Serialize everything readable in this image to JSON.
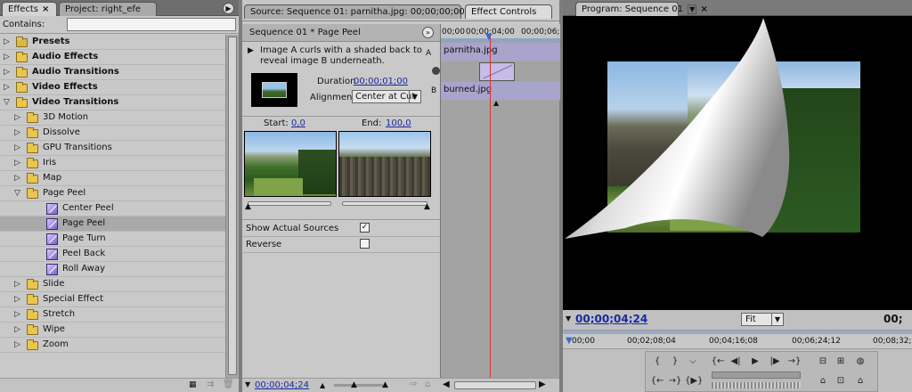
{
  "effects_panel": {
    "tabs": [
      {
        "label": "Effects",
        "close": "×"
      },
      {
        "label": "Project: right_efe"
      }
    ],
    "menu_glyph": "▶",
    "contains_label": "Contains:",
    "contains_value": "",
    "tree": [
      {
        "label": "Presets",
        "level": 0,
        "bold": true,
        "icon": "preset-folder-icon"
      },
      {
        "label": "Audio Effects",
        "level": 0,
        "bold": true,
        "icon": "folder-icon"
      },
      {
        "label": "Audio Transitions",
        "level": 0,
        "bold": true,
        "icon": "folder-icon"
      },
      {
        "label": "Video Effects",
        "level": 0,
        "bold": true,
        "icon": "folder-icon"
      },
      {
        "label": "Video Transitions",
        "level": 0,
        "bold": true,
        "expanded": true,
        "icon": "folder-icon"
      },
      {
        "label": "3D Motion",
        "level": 1,
        "icon": "folder-icon"
      },
      {
        "label": "Dissolve",
        "level": 1,
        "icon": "folder-icon"
      },
      {
        "label": "GPU Transitions",
        "level": 1,
        "icon": "folder-icon"
      },
      {
        "label": "Iris",
        "level": 1,
        "icon": "folder-icon"
      },
      {
        "label": "Map",
        "level": 1,
        "icon": "folder-icon"
      },
      {
        "label": "Page Peel",
        "level": 1,
        "expanded": true,
        "icon": "folder-icon"
      },
      {
        "label": "Center Peel",
        "level": 2,
        "icon": "transition-icon"
      },
      {
        "label": "Page Peel",
        "level": 2,
        "selected": true,
        "icon": "transition-icon"
      },
      {
        "label": "Page Turn",
        "level": 2,
        "icon": "transition-icon"
      },
      {
        "label": "Peel Back",
        "level": 2,
        "icon": "transition-icon"
      },
      {
        "label": "Roll Away",
        "level": 2,
        "icon": "transition-icon"
      },
      {
        "label": "Slide",
        "level": 1,
        "icon": "folder-icon"
      },
      {
        "label": "Special Effect",
        "level": 1,
        "icon": "folder-icon"
      },
      {
        "label": "Stretch",
        "level": 1,
        "icon": "folder-icon"
      },
      {
        "label": "Wipe",
        "level": 1,
        "icon": "folder-icon"
      },
      {
        "label": "Zoom",
        "level": 1,
        "icon": "folder-icon"
      }
    ]
  },
  "effect_controls": {
    "tabs": [
      {
        "label": "Source: Sequence 01: parnitha.jpg: 00;00;00;00"
      },
      {
        "label": "Effect Controls"
      }
    ],
    "header_title": "Sequence 01 * Page Peel",
    "description": "Image A curls with a shaded back to reveal image B underneath.",
    "duration_label": "Duration",
    "duration_value": "00;00;01;00",
    "alignment_label": "Alignment:",
    "alignment_value": "Center at Cut",
    "start_label": "Start:",
    "start_value": "0,0",
    "end_label": "End:",
    "end_value": "100,0",
    "show_actual_sources_label": "Show Actual Sources",
    "show_actual_sources_checked": true,
    "reverse_label": "Reverse",
    "reverse_checked": false,
    "timeline_timecodes": [
      "00;00",
      "00;00;04;00",
      "00;00;06;"
    ],
    "track_a_label": "A",
    "track_a_clip": "parnitha.jpg",
    "track_b_label": "B",
    "track_b_clip": "burned.jpg",
    "current_time": "00;00;04;24"
  },
  "program_monitor": {
    "tab_label": "Program: Sequence 01",
    "current_time": "00;00;04;24",
    "zoom_value": "Fit",
    "right_time": "00;",
    "ruler_ticks": [
      "00;00",
      "00;02;08;04",
      "00;04;16;08",
      "00;06;24;12",
      "00;08;32;1"
    ]
  }
}
